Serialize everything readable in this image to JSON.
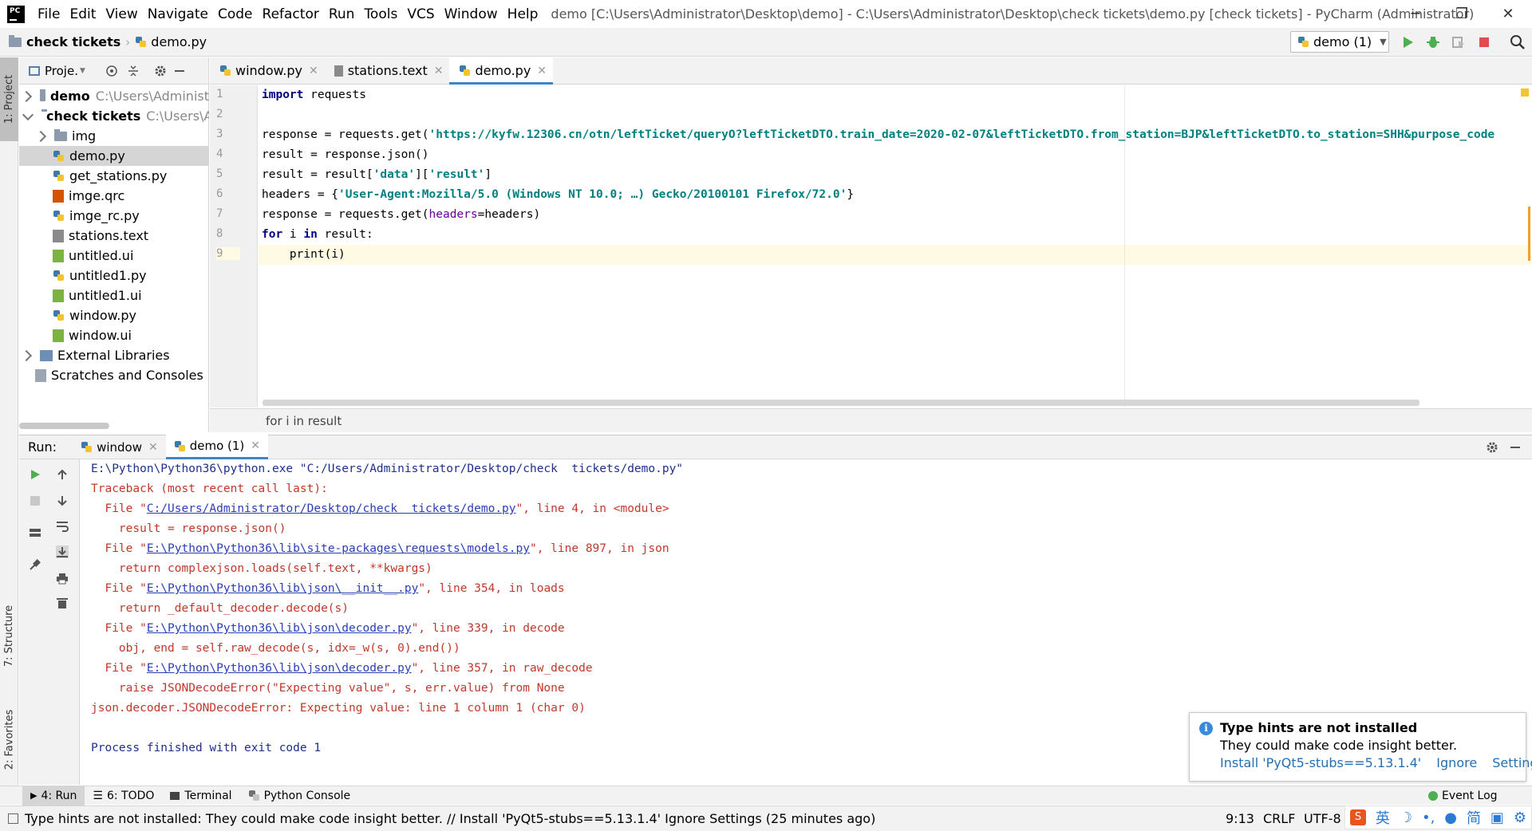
{
  "titlebar": {
    "menu": [
      "File",
      "Edit",
      "View",
      "Navigate",
      "Code",
      "Refactor",
      "Run",
      "Tools",
      "VCS",
      "Window",
      "Help"
    ],
    "window_title": "demo [C:\\Users\\Administrator\\Desktop\\demo] - C:\\Users\\Administrator\\Desktop\\check  tickets\\demo.py [check  tickets] - PyCharm (Administrator)",
    "minimize": "─",
    "maximize": "❐",
    "close": "✕"
  },
  "navbar": {
    "project": "check  tickets",
    "file": "demo.py",
    "run_config": "demo (1)"
  },
  "stripe": {
    "project": "1: Project",
    "structure": "7: Structure",
    "favorites": "2: Favorites"
  },
  "project_panel": {
    "title": "Proje.",
    "items": [
      {
        "label": "demo",
        "path": "C:\\Users\\Administ"
      },
      {
        "label": "check  tickets",
        "path": "C:\\Users\\A"
      },
      {
        "label": "img"
      },
      {
        "label": "demo.py"
      },
      {
        "label": "get_stations.py"
      },
      {
        "label": "imge.qrc"
      },
      {
        "label": "imge_rc.py"
      },
      {
        "label": "stations.text"
      },
      {
        "label": "untitled.ui"
      },
      {
        "label": "untitled1.py"
      },
      {
        "label": "untitled1.ui"
      },
      {
        "label": "window.py"
      },
      {
        "label": "window.ui"
      },
      {
        "label": "External Libraries"
      },
      {
        "label": "Scratches and Consoles"
      }
    ]
  },
  "editor": {
    "tabs": [
      "window.py",
      "stations.text",
      "demo.py"
    ],
    "active_tab": "demo.py",
    "line_numbers": [
      "1",
      "2",
      "3",
      "4",
      "5",
      "6",
      "7",
      "8",
      "9"
    ],
    "lines": {
      "l1_kw": "import",
      "l1_rest": " requests",
      "l3_a": "response = requests.get(",
      "l3_str": "'https://kyfw.12306.cn/otn/leftTicket/queryO?leftTicketDTO.train_date=2020-02-07&leftTicketDTO.from_station=BJP&leftTicketDTO.to_station=SHH&purpose_code",
      "l4": "result = response.json()",
      "l5_a": "result = result[",
      "l5_s1": "'data'",
      "l5_b": "][",
      "l5_s2": "'result'",
      "l5_c": "]",
      "l6_a": "headers = {",
      "l6_str": "'User-Agent:Mozilla/5.0 (Windows NT 10.0; …) Gecko/20100101 Firefox/72.0'",
      "l6_b": "}",
      "l7_a": "response = requests.get(",
      "l7_p": "headers",
      "l7_b": "=headers)",
      "l8_kw1": "for",
      "l8_a": " i ",
      "l8_kw2": "in",
      "l8_b": " result:",
      "l9": "    print(i)"
    },
    "breadcrumb": "for i in result"
  },
  "run_panel": {
    "label": "Run:",
    "tabs": [
      "window",
      "demo (1)"
    ],
    "console": {
      "cmd": "E:\\Python\\Python36\\python.exe \"C:/Users/Administrator/Desktop/check  tickets/demo.py\"",
      "tb": "Traceback (most recent call last):",
      "f1_pre": "  File \"",
      "f1_link": "C:/Users/Administrator/Desktop/check  tickets/demo.py",
      "f1_post": "\", line 4, in <module>",
      "c1": "    result = response.json()",
      "f2_link": "E:\\Python\\Python36\\lib\\site-packages\\requests\\models.py",
      "f2_post": "\", line 897, in json",
      "c2": "    return complexjson.loads(self.text, **kwargs)",
      "f3_link": "E:\\Python\\Python36\\lib\\json\\__init__.py",
      "f3_post": "\", line 354, in loads",
      "c3": "    return _default_decoder.decode(s)",
      "f4_link": "E:\\Python\\Python36\\lib\\json\\decoder.py",
      "f4_post": "\", line 339, in decode",
      "c4": "    obj, end = self.raw_decode(s, idx=_w(s, 0).end())",
      "f5_link": "E:\\Python\\Python36\\lib\\json\\decoder.py",
      "f5_post": "\", line 357, in raw_decode",
      "c5": "    raise JSONDecodeError(\"Expecting value\", s, err.value) from None",
      "err": "json.decoder.JSONDecodeError: Expecting value: line 1 column 1 (char 0)",
      "exit": "Process finished with exit code 1"
    }
  },
  "notification": {
    "title": "Type hints are not installed",
    "body": "They could make code insight better.",
    "install": "Install 'PyQt5-stubs==5.13.1.4'",
    "ignore": "Ignore",
    "settings": "Settings"
  },
  "tool_tabs": [
    "4: Run",
    "6: TODO",
    "Terminal",
    "Python Console",
    "Event Log"
  ],
  "statusbar": {
    "message": "Type hints are not installed: They could make code insight better. // Install 'PyQt5-stubs==5.13.1.4'   Ignore   Settings (25 minutes ago)",
    "position": "9:13",
    "line_sep": "CRLF",
    "encoding": "UTF-8"
  },
  "ime": [
    "英",
    "简"
  ]
}
